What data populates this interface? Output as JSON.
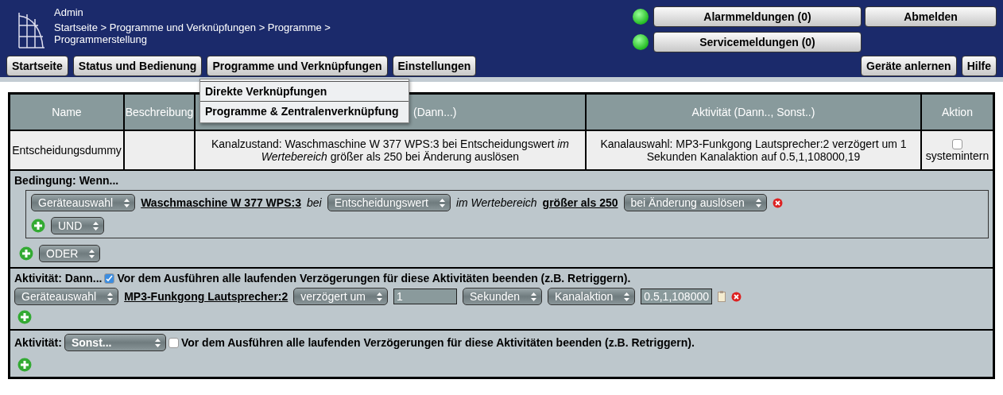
{
  "header": {
    "user": "Admin",
    "breadcrumb": "Startseite > Programme und Verknüpfungen > Programme > Programmerstellung",
    "messages": [
      {
        "label": "Alarmmeldungen (0)",
        "ok": true
      },
      {
        "label": "Servicemeldungen (0)",
        "ok": true
      }
    ],
    "logout": "Abmelden",
    "nav": [
      "Startseite",
      "Status und Bedienung",
      "Programme und Verknüpfungen",
      "Einstellungen"
    ],
    "nav_right": [
      "Geräte anlernen",
      "Hilfe"
    ],
    "menu": {
      "items": [
        "Direkte Verknüpfungen",
        "Programme & Zentralenverknüpfung"
      ]
    }
  },
  "table": {
    "columns": [
      "Name",
      "Beschreibung",
      "(Dann...)",
      "Aktivität (Dann.., Sonst..)",
      "Aktion"
    ],
    "row": {
      "name": "Entscheidungsdummy",
      "condition": "Kanalzustand: Waschmaschine W 377 WPS:3 bei Entscheidungswert *im Wertebereich* größer als 250 bei Änderung auslösen",
      "activity": "Kanalauswahl: MP3-Funkgong Lautsprecher:2 verzögert um 1 Sekunden Kanalaktion auf 0.5,1,108000,19",
      "internal": {
        "label": "systemintern",
        "checked": false
      }
    }
  },
  "condition": {
    "title": "Bedingung: Wenn...",
    "parts": [
      {
        "kind": "select",
        "text": "Geräteauswahl"
      },
      {
        "kind": "link",
        "text": "Waschmaschine W 377 WPS:3"
      },
      {
        "kind": "text",
        "text": "bei"
      },
      {
        "kind": "select",
        "text": "Entscheidungswert"
      },
      {
        "kind": "text",
        "text": "im Wertebereich"
      },
      {
        "kind": "link",
        "text": "größer als 250"
      },
      {
        "kind": "select",
        "text": "bei Änderung auslösen"
      },
      {
        "kind": "delete"
      }
    ],
    "and": "UND",
    "or": "ODER"
  },
  "then": {
    "title": "Aktivität: Dann...",
    "stop_delays": {
      "label": "Vor dem Ausführen alle laufenden Verzögerungen für diese Aktivitäten beenden (z.B. Retriggern).",
      "checked": true
    },
    "parts": [
      {
        "kind": "select",
        "text": "Geräteauswahl"
      },
      {
        "kind": "link",
        "text": "MP3-Funkgong Lautsprecher:2"
      },
      {
        "kind": "select",
        "text": "verzögert um"
      },
      {
        "kind": "input",
        "text": "1"
      },
      {
        "kind": "select",
        "text": "Sekunden"
      },
      {
        "kind": "select",
        "text": "Kanalaktion"
      },
      {
        "kind": "input",
        "text": "0.5,1,108000"
      },
      {
        "kind": "clipboard"
      },
      {
        "kind": "delete"
      }
    ]
  },
  "else": {
    "title": "Aktivität:",
    "select": "Sonst...",
    "stop_delays": {
      "label": "Vor dem Ausführen alle laufenden Verzögerungen für diese Aktivitäten beenden (z.B. Retriggern).",
      "checked": false
    }
  }
}
